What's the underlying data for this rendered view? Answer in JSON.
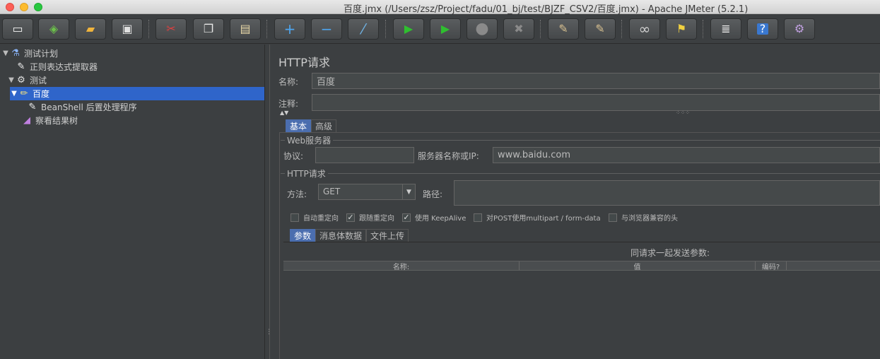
{
  "window": {
    "title": "百度.jmx (/Users/zsz/Project/fadu/01_bj/test/BJZF_CSV2/百度.jmx) - Apache JMeter (5.2.1)"
  },
  "toolbar": {
    "buttons": [
      {
        "name": "new",
        "icon": "new-file-icon",
        "glyph": "▭"
      },
      {
        "name": "templates",
        "icon": "templates-icon",
        "glyph": "◈"
      },
      {
        "name": "open",
        "icon": "open-folder-icon",
        "glyph": "▰"
      },
      {
        "name": "save",
        "icon": "save-icon",
        "glyph": "▣"
      },
      {
        "name": "cut",
        "icon": "cut-icon",
        "glyph": "✂"
      },
      {
        "name": "copy",
        "icon": "copy-icon",
        "glyph": "❐"
      },
      {
        "name": "paste",
        "icon": "paste-icon",
        "glyph": "▤"
      },
      {
        "name": "expand",
        "icon": "plus-icon",
        "glyph": "+"
      },
      {
        "name": "collapse",
        "icon": "minus-icon",
        "glyph": "−"
      },
      {
        "name": "toggle",
        "icon": "toggle-icon",
        "glyph": "⁄"
      },
      {
        "name": "start",
        "icon": "start-icon",
        "glyph": "▶"
      },
      {
        "name": "start-no-pause",
        "icon": "start-no-pause-icon",
        "glyph": "▶"
      },
      {
        "name": "stop",
        "icon": "stop-icon",
        "glyph": "●"
      },
      {
        "name": "shutdown",
        "icon": "shutdown-icon",
        "glyph": "✖"
      },
      {
        "name": "clear",
        "icon": "clear-icon",
        "glyph": "✎"
      },
      {
        "name": "clear-all",
        "icon": "clear-all-icon",
        "glyph": "✎"
      },
      {
        "name": "search",
        "icon": "binoculars-icon",
        "glyph": "∞"
      },
      {
        "name": "reset-search",
        "icon": "broom-icon",
        "glyph": "⚑"
      },
      {
        "name": "function-helper",
        "icon": "function-list-icon",
        "glyph": "≣"
      },
      {
        "name": "help",
        "icon": "help-icon",
        "glyph": "?"
      },
      {
        "name": "remote",
        "icon": "remote-icon",
        "glyph": "⚙"
      }
    ]
  },
  "tree": {
    "items": [
      {
        "label": "测试计划",
        "icon": "test-plan-icon",
        "glyph": "⚗"
      },
      {
        "label": "正则表达式提取器",
        "icon": "extractor-icon",
        "glyph": "✎"
      },
      {
        "label": "测试",
        "icon": "thread-group-icon",
        "glyph": "⚙"
      },
      {
        "label": "百度",
        "icon": "sampler-icon",
        "glyph": "✏"
      },
      {
        "label": "BeanShell 后置处理程序",
        "icon": "postprocessor-icon",
        "glyph": "✎"
      },
      {
        "label": "察看结果树",
        "icon": "listener-icon",
        "glyph": "◢"
      }
    ]
  },
  "panel": {
    "title": "HTTP请求",
    "name_label": "名称:",
    "name_value": "百度",
    "comment_label": "注释:",
    "comment_value": "",
    "tabs": [
      "基本",
      "高级"
    ],
    "web_server": {
      "title": "Web服务器",
      "protocol_label": "协议:",
      "protocol_value": "",
      "server_label": "服务器名称或IP:",
      "server_value": "www.baidu.com"
    },
    "http_request": {
      "title": "HTTP请求",
      "method_label": "方法:",
      "method_value": "GET",
      "path_label": "路径:",
      "path_value": "",
      "checkboxes": [
        {
          "label": "自动重定向",
          "checked": false
        },
        {
          "label": "跟随重定向",
          "checked": true
        },
        {
          "label": "使用 KeepAlive",
          "checked": true
        },
        {
          "label": "对POST使用multipart / form-data",
          "checked": false
        },
        {
          "label": "与浏览器兼容的头",
          "checked": false
        }
      ]
    },
    "param_tabs": [
      "参数",
      "消息体数据",
      "文件上传"
    ],
    "params": {
      "caption": "同请求一起发送参数:",
      "columns": [
        "名称:",
        "值",
        "编码?"
      ]
    }
  }
}
